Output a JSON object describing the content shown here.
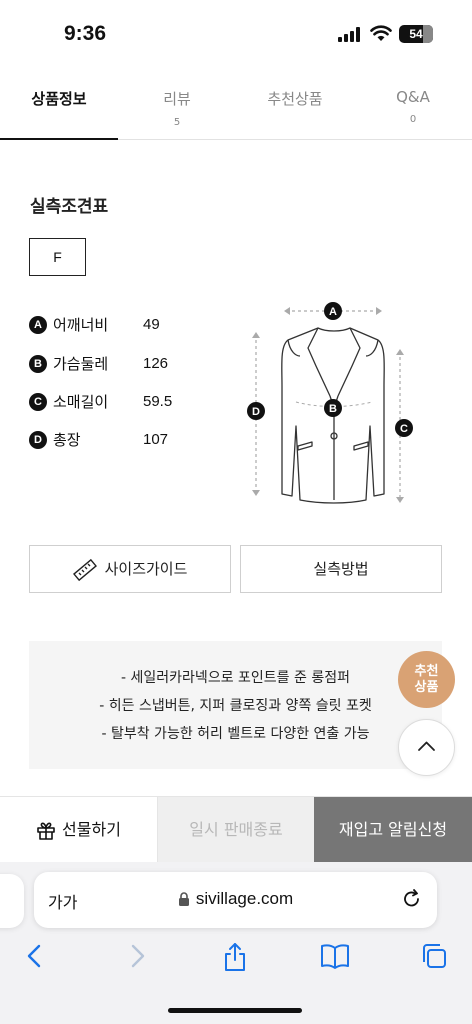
{
  "status": {
    "time": "9:36",
    "battery": "54"
  },
  "tabs": [
    {
      "label": "상품정보",
      "count": ""
    },
    {
      "label": "리뷰",
      "count": "5"
    },
    {
      "label": "추천상품",
      "count": ""
    },
    {
      "label": "Q&A",
      "count": "0"
    }
  ],
  "size_table": {
    "title": "실측조견표",
    "selected_size": "F",
    "measurements": [
      {
        "key": "A",
        "name": "어깨너비",
        "value": "49"
      },
      {
        "key": "B",
        "name": "가슴둘레",
        "value": "126"
      },
      {
        "key": "C",
        "name": "소매길이",
        "value": "59.5"
      },
      {
        "key": "D",
        "name": "총장",
        "value": "107"
      }
    ],
    "diagram_labels": [
      "A",
      "B",
      "C",
      "D"
    ]
  },
  "buttons": {
    "size_guide": "사이즈가이드",
    "measure_method": "실측방법"
  },
  "description": [
    "- 세일러카라넥으로 포인트를 준 롱점퍼",
    "- 히든 스냅버튼, 지퍼 클로징과 양쪽 슬릿 포켓",
    "- 탈부착 가능한 허리 벨트로 다양한 연출 가능"
  ],
  "floating": {
    "recommend_line1": "추천",
    "recommend_line2": "상품"
  },
  "action_bar": {
    "gift": "선물하기",
    "soldout": "일시 판매종료",
    "restock": "재입고 알림신청"
  },
  "browser": {
    "text_size": "가가",
    "url": "sivillage.com"
  },
  "colors": {
    "recommend": "#d9a274",
    "restock_bg": "#767676",
    "safari_blue": "#1a73e8"
  }
}
